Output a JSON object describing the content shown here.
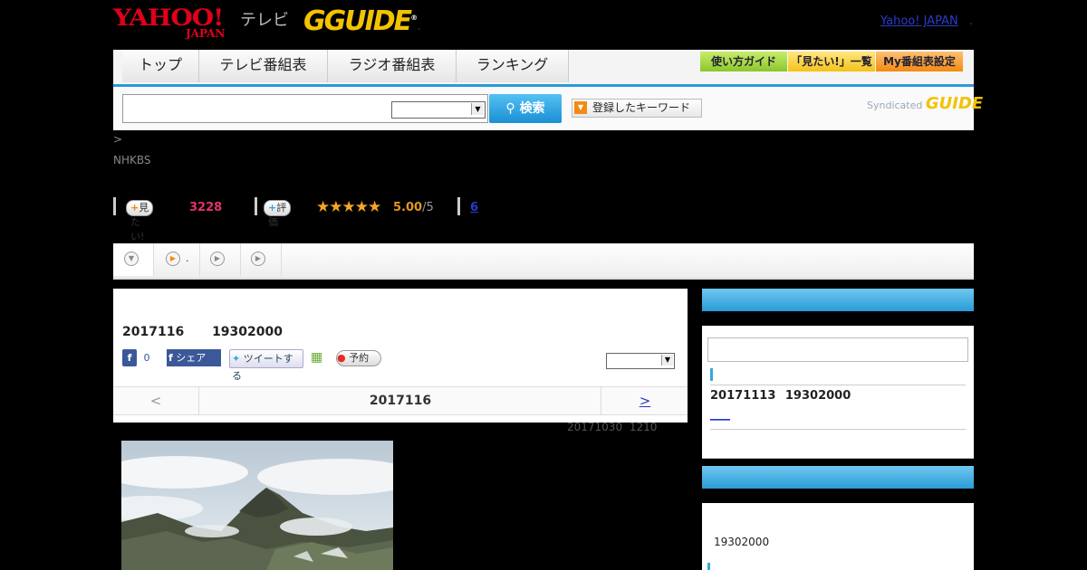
{
  "header": {
    "yahoo_logo": "YAHOO!",
    "yahoo_japan": "JAPAN",
    "tv_label": "テレビ",
    "gguide_logo": "GUIDE",
    "gguide_mark": "®",
    "top_link": "Yahoo! JAPAN",
    "small_mark": ".",
    "small_mark2": "."
  },
  "nav": {
    "tabs": [
      "トップ",
      "テレビ番組表",
      "ラジオ番組表",
      "ランキング"
    ],
    "buttons": [
      "使い方ガイド",
      "「見たい!」一覧",
      "My番組表設定"
    ]
  },
  "search": {
    "button_label": "検索",
    "keyword_button": "登録したキーワード",
    "syndicated": "Syndicated",
    "syndicated_logo": "GUIDE"
  },
  "breadcrumb": ">",
  "channel": "NHKBS",
  "stats": {
    "want_label": "見たい!",
    "want_count": "3228",
    "rate_label": "評価",
    "stars": "★★★★★",
    "rating": "5.00",
    "rating_of": "/5",
    "comments": "6"
  },
  "tabs_bar": {
    "tab2_dot": "."
  },
  "program": {
    "date_title": "2017116 19302000",
    "fb_count": "0",
    "fb_share": "シェア",
    "tweet": "ツイートする",
    "reserve": "予約",
    "pager_prev": "<",
    "pager_date": "2017116",
    "pager_next": ">",
    "updated": "20171030 1210"
  },
  "sidebar": {
    "next_air": "20171113 19302000",
    "link": "____",
    "time": "19302000"
  }
}
